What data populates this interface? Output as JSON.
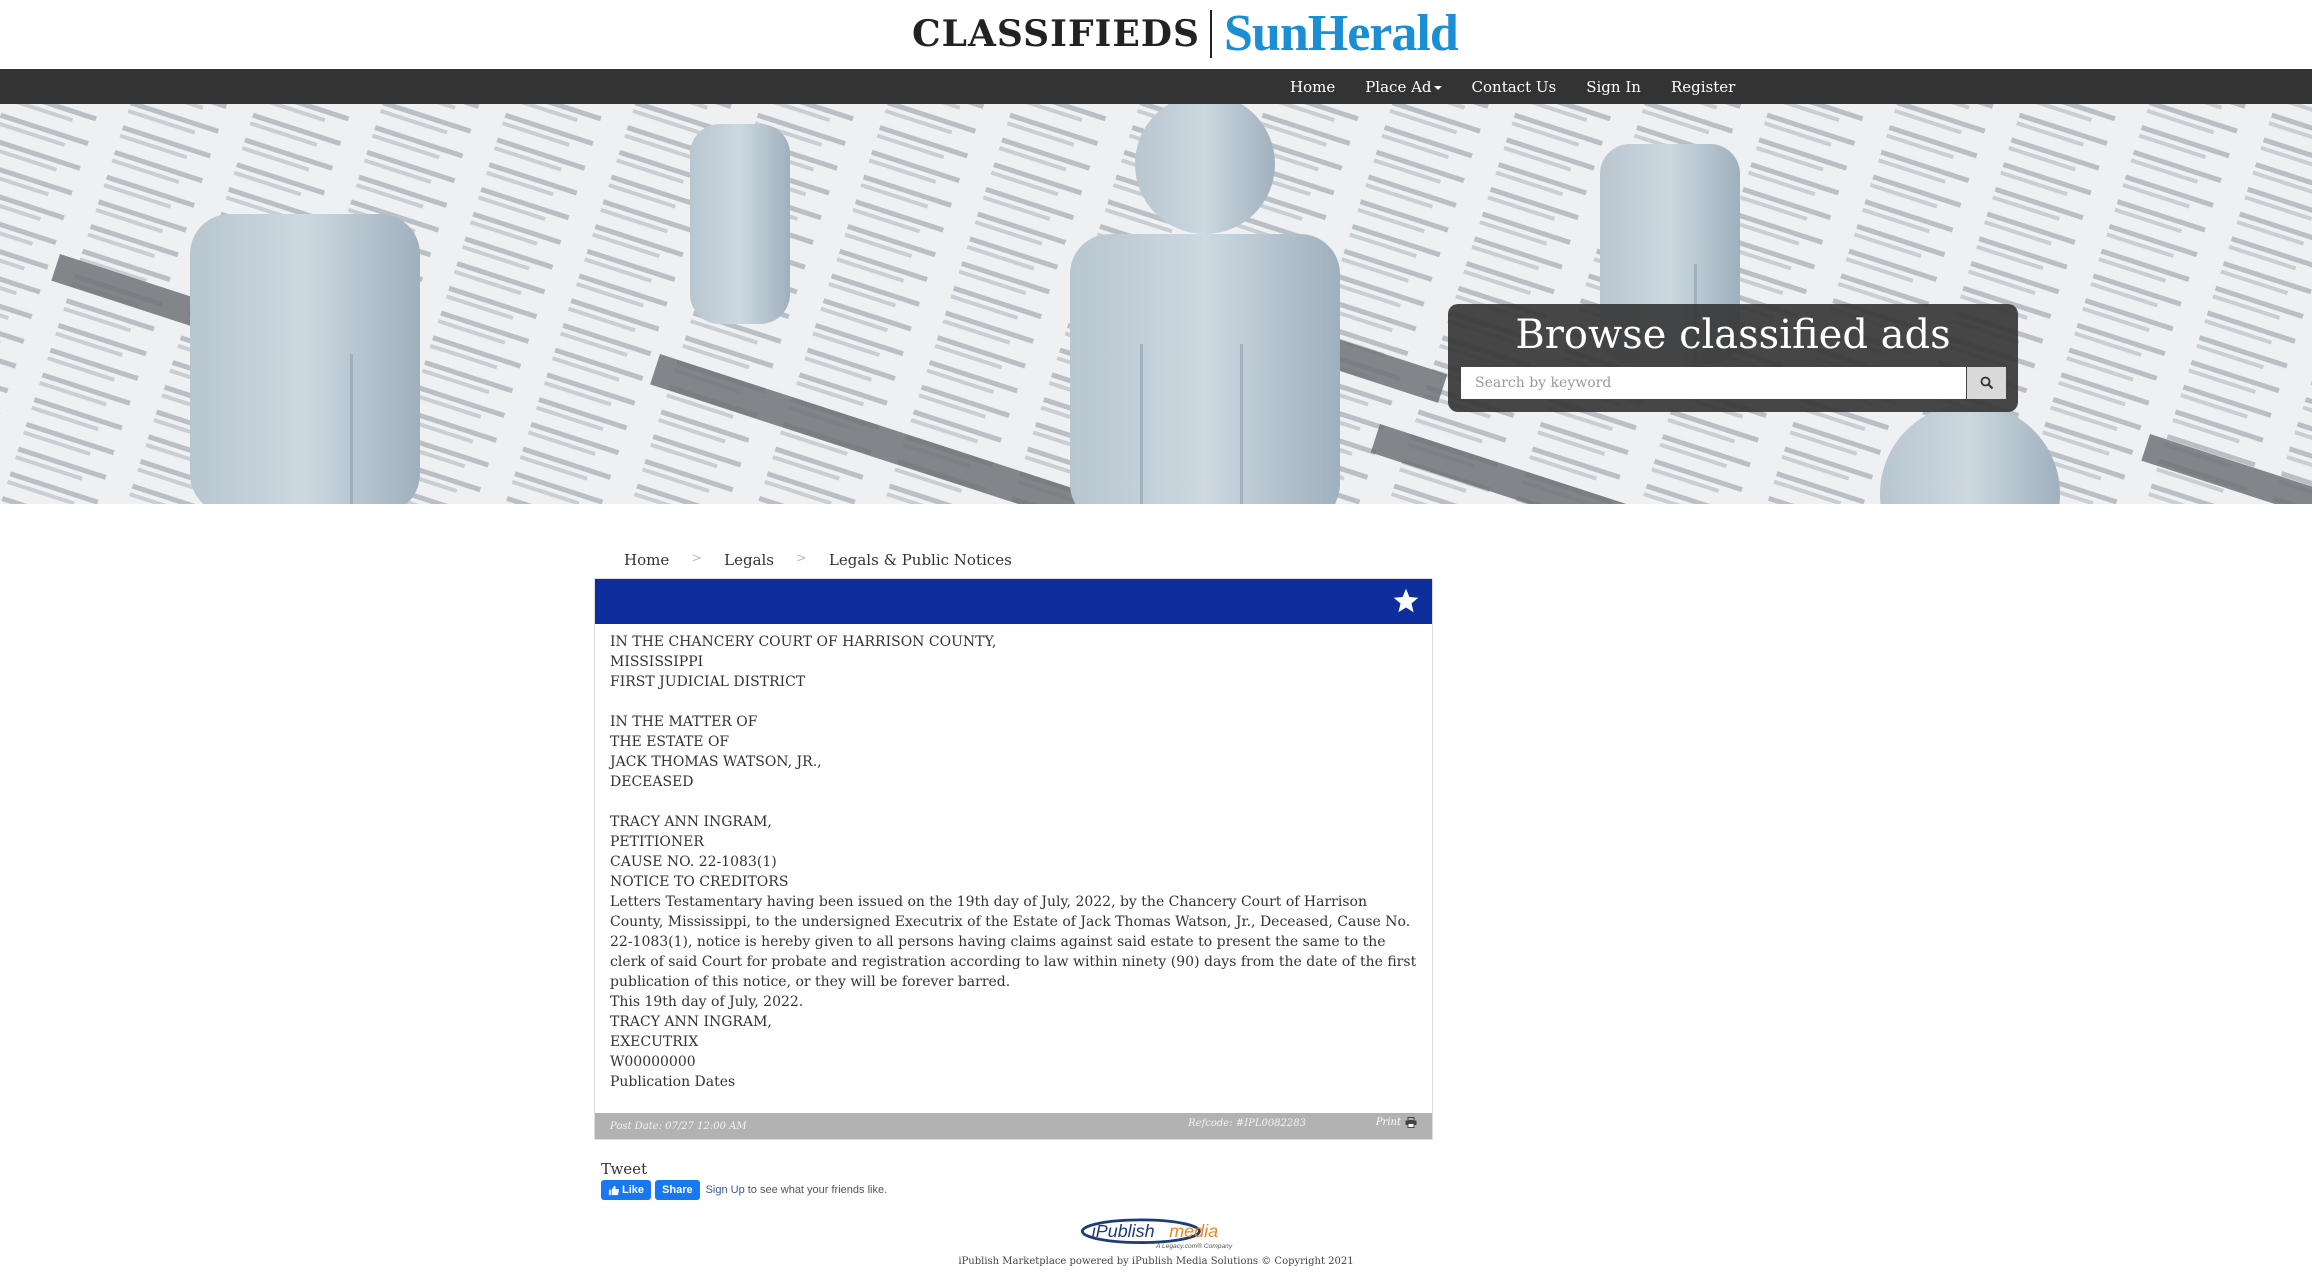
{
  "header": {
    "logo_left": "CLASSIFIEDS",
    "logo_right": "SunHerald"
  },
  "nav": {
    "items": [
      "Home",
      "Place Ad",
      "Contact Us",
      "Sign In",
      "Register"
    ]
  },
  "hero": {
    "title": "Browse classified ads",
    "search_placeholder": "Search by keyword"
  },
  "breadcrumb": [
    "Home",
    "Legals",
    "Legals & Public Notices"
  ],
  "ad": {
    "lines_block1": [
      "IN THE CHANCERY COURT OF HARRISON COUNTY,",
      "MISSISSIPPI",
      "FIRST JUDICIAL DISTRICT"
    ],
    "lines_block2": [
      "IN THE MATTER OF",
      "THE ESTATE OF",
      "JACK THOMAS WATSON, JR.,",
      "DECEASED"
    ],
    "lines_block3": [
      "TRACY ANN INGRAM,",
      "PETITIONER",
      "CAUSE NO. 22-1083(1)",
      "NOTICE TO CREDITORS"
    ],
    "paragraph": "Letters Testamentary having been issued on the 19th day of July, 2022, by the Chancery Court of Harrison County, Mississippi, to the undersigned Executrix of the Estate of Jack Thomas Watson, Jr., Deceased, Cause No. 22-1083(1), notice is hereby given to all persons having claims against said estate to present the same to the clerk of said Court for probate and registration according to law within ninety (90) days from the date of the first publication of this notice, or they will be forever barred.",
    "lines_block4": [
      "This 19th day of July, 2022.",
      "TRACY ANN INGRAM,",
      "EXECUTRIX",
      "W00000000",
      "Publication Dates"
    ],
    "post_date": "Post Date: 07/27 12:00 AM",
    "ref_code": "Refcode: #IPL0082283",
    "print_label": "Print"
  },
  "social": {
    "tweet": "Tweet",
    "fb_like": "Like",
    "fb_share": "Share",
    "fb_signup": "Sign Up",
    "fb_text": "to see what your friends like."
  },
  "footer": {
    "logo_word1": "iPublish",
    "logo_word2": "media",
    "logo_sub": "A Legacy.com® Company",
    "copyright": "iPublish Marketplace powered by iPublish Media Solutions © Copyright 2021"
  },
  "colors": {
    "brand_blue": "#1a8fd4",
    "card_header": "#0d2e9c",
    "navbar": "#333333",
    "facebook": "#1877f2"
  }
}
